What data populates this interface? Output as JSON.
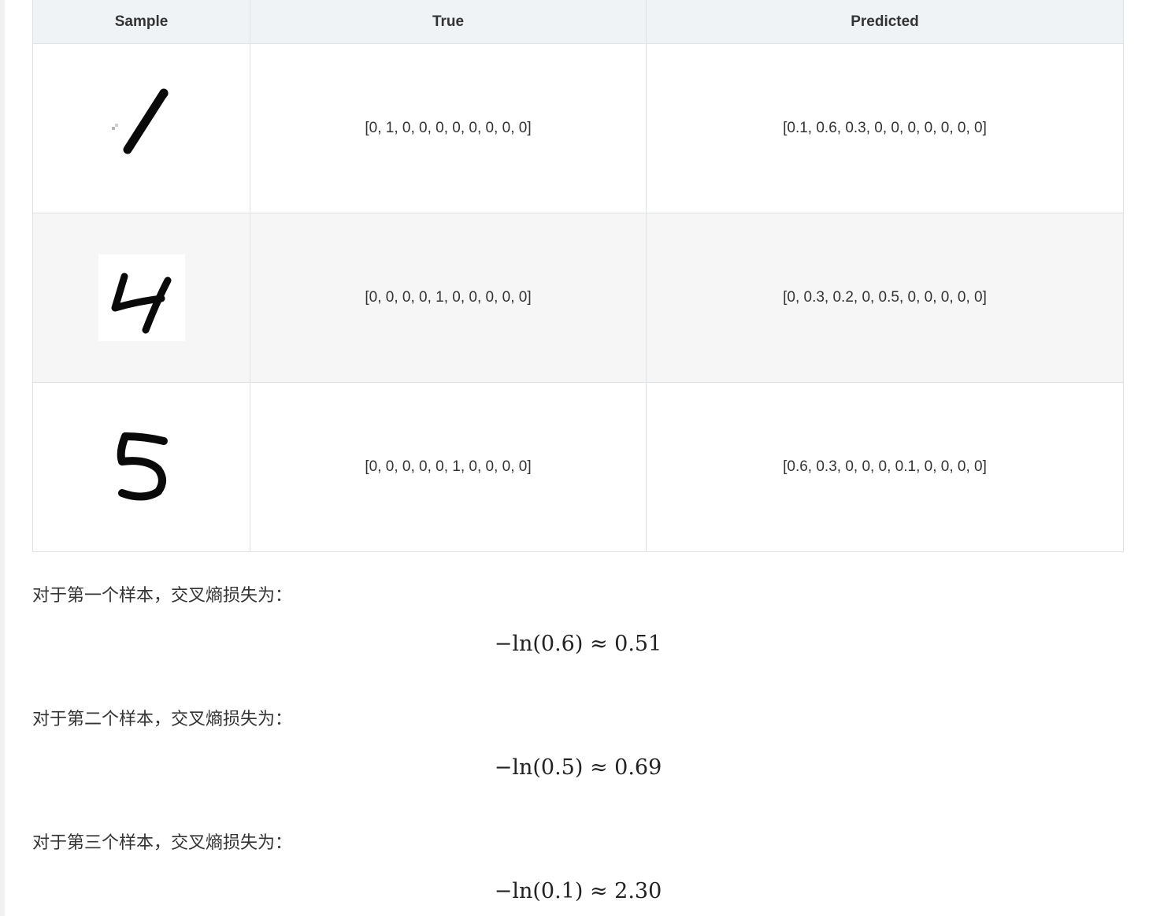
{
  "table": {
    "headers": [
      "Sample",
      "True",
      "Predicted"
    ],
    "rows": [
      {
        "sample_icon": "handwritten-digit-1-icon",
        "true": "[0, 1, 0, 0, 0, 0, 0, 0, 0, 0]",
        "predicted": "[0.1, 0.6, 0.3, 0, 0, 0, 0, 0, 0, 0]"
      },
      {
        "sample_icon": "handwritten-digit-4-icon",
        "true": "[0, 0, 0, 0, 1, 0, 0, 0, 0, 0]",
        "predicted": "[0, 0.3, 0.2, 0, 0.5, 0, 0, 0, 0, 0]"
      },
      {
        "sample_icon": "handwritten-digit-5-icon",
        "true": "[0, 0, 0, 0, 0, 1, 0, 0, 0, 0]",
        "predicted": "[0.6, 0.3, 0, 0, 0, 0.1, 0, 0, 0, 0]"
      }
    ]
  },
  "explanations": [
    {
      "text": "对于第一个样本，交叉熵损失为：",
      "formula": "−ln(0.6) ≈ 0.51"
    },
    {
      "text": "对于第二个样本，交叉熵损失为：",
      "formula": "−ln(0.5) ≈ 0.69"
    },
    {
      "text": "对于第三个样本，交叉熵损失为：",
      "formula": "−ln(0.1) ≈ 2.30"
    }
  ]
}
